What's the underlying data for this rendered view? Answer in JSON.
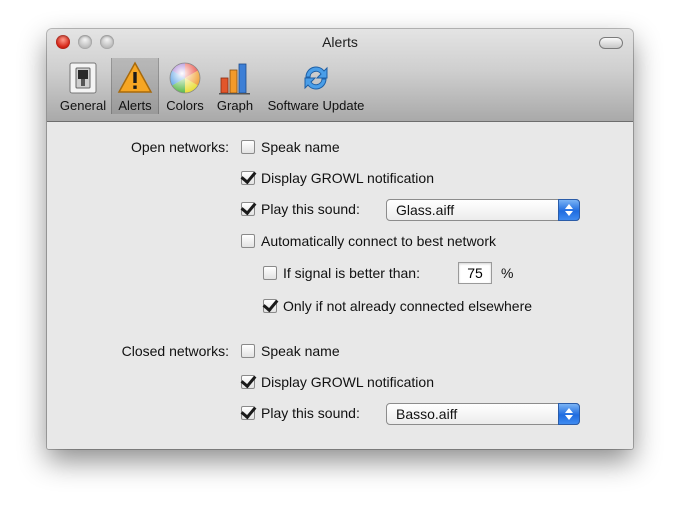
{
  "window": {
    "title": "Alerts"
  },
  "toolbar": {
    "items": [
      {
        "label": "General",
        "icon": "switch-icon"
      },
      {
        "label": "Alerts",
        "icon": "warning-icon",
        "selected": true
      },
      {
        "label": "Colors",
        "icon": "color-wheel-icon"
      },
      {
        "label": "Graph",
        "icon": "bar-graph-icon"
      },
      {
        "label": "Software Update",
        "icon": "refresh-icon"
      }
    ]
  },
  "open_networks": {
    "label": "Open networks:",
    "speak_name": {
      "label": "Speak name",
      "checked": false
    },
    "display_growl": {
      "label": "Display GROWL notification",
      "checked": true
    },
    "play_sound": {
      "label": "Play this sound:",
      "checked": true,
      "sound": "Glass.aiff"
    },
    "auto_connect": {
      "label": "Automatically connect to best network",
      "checked": false
    },
    "signal_better": {
      "label": "If signal is better than:",
      "checked": false,
      "value": "75",
      "unit": "%"
    },
    "only_if_not_connected": {
      "label": "Only if not already connected elsewhere",
      "checked": true
    }
  },
  "closed_networks": {
    "label": "Closed networks:",
    "speak_name": {
      "label": "Speak name",
      "checked": false
    },
    "display_growl": {
      "label": "Display GROWL notification",
      "checked": true
    },
    "play_sound": {
      "label": "Play this sound:",
      "checked": true,
      "sound": "Basso.aiff"
    }
  },
  "colors": {
    "accent": "#1f6ce0",
    "close_button": "#d7281a"
  }
}
